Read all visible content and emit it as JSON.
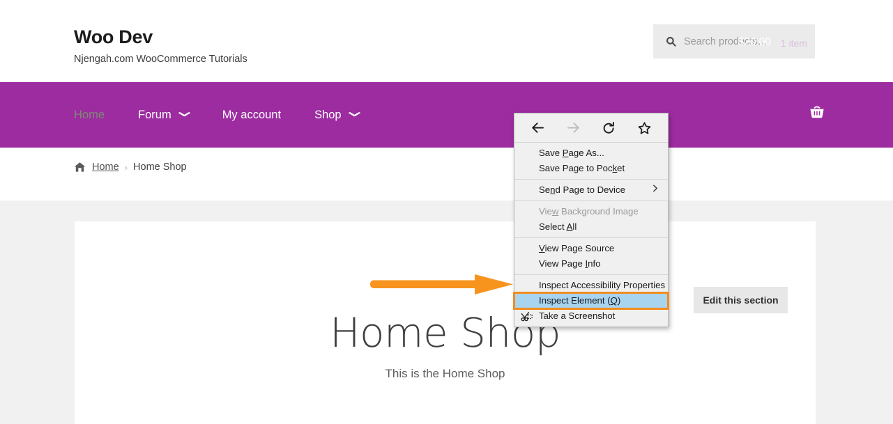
{
  "site": {
    "title": "Woo Dev",
    "tagline": "Njengah.com WooCommerce Tutorials"
  },
  "search": {
    "placeholder": "Search products…",
    "value": "",
    "icon": "search-icon"
  },
  "nav": {
    "items": [
      {
        "label": "Home",
        "active": true,
        "caret": false
      },
      {
        "label": "Forum",
        "active": false,
        "caret": true
      },
      {
        "label": "My account",
        "active": false,
        "caret": false
      },
      {
        "label": "Shop",
        "active": false,
        "caret": true
      }
    ],
    "caret_glyph": "⌄",
    "background_color": "#9c2ca0",
    "active_color": "#7e8a73"
  },
  "cart": {
    "amount": "$20.00",
    "item_count": "1 item",
    "icon": "shopping-basket-icon"
  },
  "breadcrumb": {
    "home_icon": "house-icon",
    "home_label": "Home",
    "separator": "›",
    "current": "Home Shop"
  },
  "main": {
    "hero_title": "Home Shop",
    "hero_subtitle": "This is the Home Shop",
    "edit_button": "Edit this section"
  },
  "annotation": {
    "arrow_color": "#f7941e",
    "description": "orange-arrow-pointing-to-inspect-element"
  },
  "context_menu": {
    "toolbar": [
      {
        "name": "back-icon",
        "enabled": true
      },
      {
        "name": "forward-icon",
        "enabled": false
      },
      {
        "name": "reload-icon",
        "enabled": true
      },
      {
        "name": "bookmark-star-icon",
        "enabled": true
      }
    ],
    "groups": [
      {
        "items": [
          {
            "label": "Save Page As...",
            "accesskey": "P",
            "disabled": false,
            "submenu": false,
            "icon": null
          },
          {
            "label": "Save Page to Pocket",
            "accesskey": "k",
            "disabled": false,
            "submenu": false,
            "icon": null
          }
        ]
      },
      {
        "items": [
          {
            "label": "Send Page to Device",
            "accesskey": "n",
            "disabled": false,
            "submenu": true,
            "icon": null
          }
        ]
      },
      {
        "items": [
          {
            "label": "View Background Image",
            "accesskey": "w",
            "disabled": true,
            "submenu": false,
            "icon": null
          },
          {
            "label": "Select All",
            "accesskey": "A",
            "disabled": false,
            "submenu": false,
            "icon": null
          }
        ]
      },
      {
        "items": [
          {
            "label": "View Page Source",
            "accesskey": "V",
            "disabled": false,
            "submenu": false,
            "icon": null
          },
          {
            "label": "View Page Info",
            "accesskey": "I",
            "disabled": false,
            "submenu": false,
            "icon": null
          }
        ]
      },
      {
        "items": [
          {
            "label": "Inspect Accessibility Properties",
            "accesskey": null,
            "disabled": false,
            "submenu": false,
            "icon": null
          },
          {
            "label": "Inspect Element (Q)",
            "accesskey": "Q",
            "disabled": false,
            "submenu": false,
            "icon": null,
            "highlighted": true
          },
          {
            "label": "Take a Screenshot",
            "accesskey": null,
            "disabled": false,
            "submenu": false,
            "icon": "screenshot-scissors-icon"
          }
        ]
      }
    ],
    "highlight_fill": "#a8d4f0",
    "highlight_border": "#f28c1e"
  }
}
